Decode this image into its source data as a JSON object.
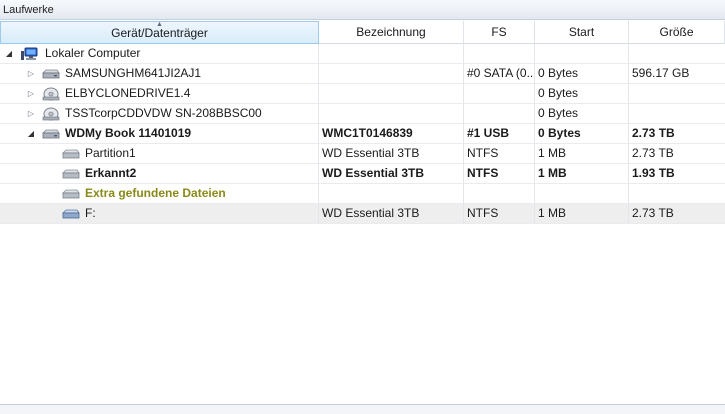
{
  "panel": {
    "title": "Laufwerke"
  },
  "columns": [
    {
      "label": "Gerät/Datenträger",
      "sorted": true
    },
    {
      "label": "Bezeichnung"
    },
    {
      "label": "FS"
    },
    {
      "label": "Start"
    },
    {
      "label": "Größe"
    }
  ],
  "rows": [
    {
      "name": "Lokaler Computer",
      "bezeichnung": "",
      "fs": "",
      "start": "",
      "groesse": "",
      "icon": "computer-icon",
      "toggle": "expanded",
      "level": 0
    },
    {
      "name": "SAMSUNGHM641JI2AJ1",
      "bezeichnung": "",
      "fs": "#0 SATA (0...",
      "start": "0 Bytes",
      "groesse": "596.17 GB",
      "icon": "hard-drive-icon",
      "toggle": "collapsed",
      "level": 1
    },
    {
      "name": "ELBYCLONEDRIVE1.4",
      "bezeichnung": "",
      "fs": "",
      "start": "0 Bytes",
      "groesse": "",
      "icon": "optical-drive-icon",
      "toggle": "collapsed",
      "level": 1
    },
    {
      "name": "TSSTcorpCDDVDW SN-208BBSC00",
      "bezeichnung": "",
      "fs": "",
      "start": "0 Bytes",
      "groesse": "",
      "icon": "optical-drive-icon",
      "toggle": "collapsed",
      "level": 1
    },
    {
      "name": "WDMy Book 11401019",
      "bezeichnung": "WMC1T0146839",
      "fs": "#1 USB",
      "start": "0 Bytes",
      "groesse": "2.73 TB",
      "icon": "hard-drive-icon",
      "toggle": "expanded",
      "level": 1,
      "bold": true
    },
    {
      "name": "Partition1",
      "bezeichnung": "WD Essential 3TB",
      "fs": "NTFS",
      "start": "1 MB",
      "groesse": "2.73 TB",
      "icon": "partition-icon",
      "toggle": "none",
      "level": 2
    },
    {
      "name": "Erkannt2",
      "bezeichnung": "WD Essential 3TB",
      "fs": "NTFS",
      "start": "1 MB",
      "groesse": "1.93 TB",
      "icon": "partition-icon",
      "toggle": "none",
      "level": 2,
      "bold": true
    },
    {
      "name": "Extra gefundene Dateien",
      "bezeichnung": "",
      "fs": "",
      "start": "",
      "groesse": "",
      "icon": "partition-icon",
      "toggle": "none",
      "level": 2,
      "olive": true
    },
    {
      "name": "F:",
      "bezeichnung": "WD Essential 3TB",
      "fs": "NTFS",
      "start": "1 MB",
      "groesse": "2.73 TB",
      "icon": "partition-blue-icon",
      "toggle": "none",
      "level": 2,
      "selected": true
    }
  ],
  "colors": {
    "header_sorted_bg": "#d9ecfa",
    "olive_text": "#8a8a18",
    "selected_row": "#eeeeee"
  }
}
